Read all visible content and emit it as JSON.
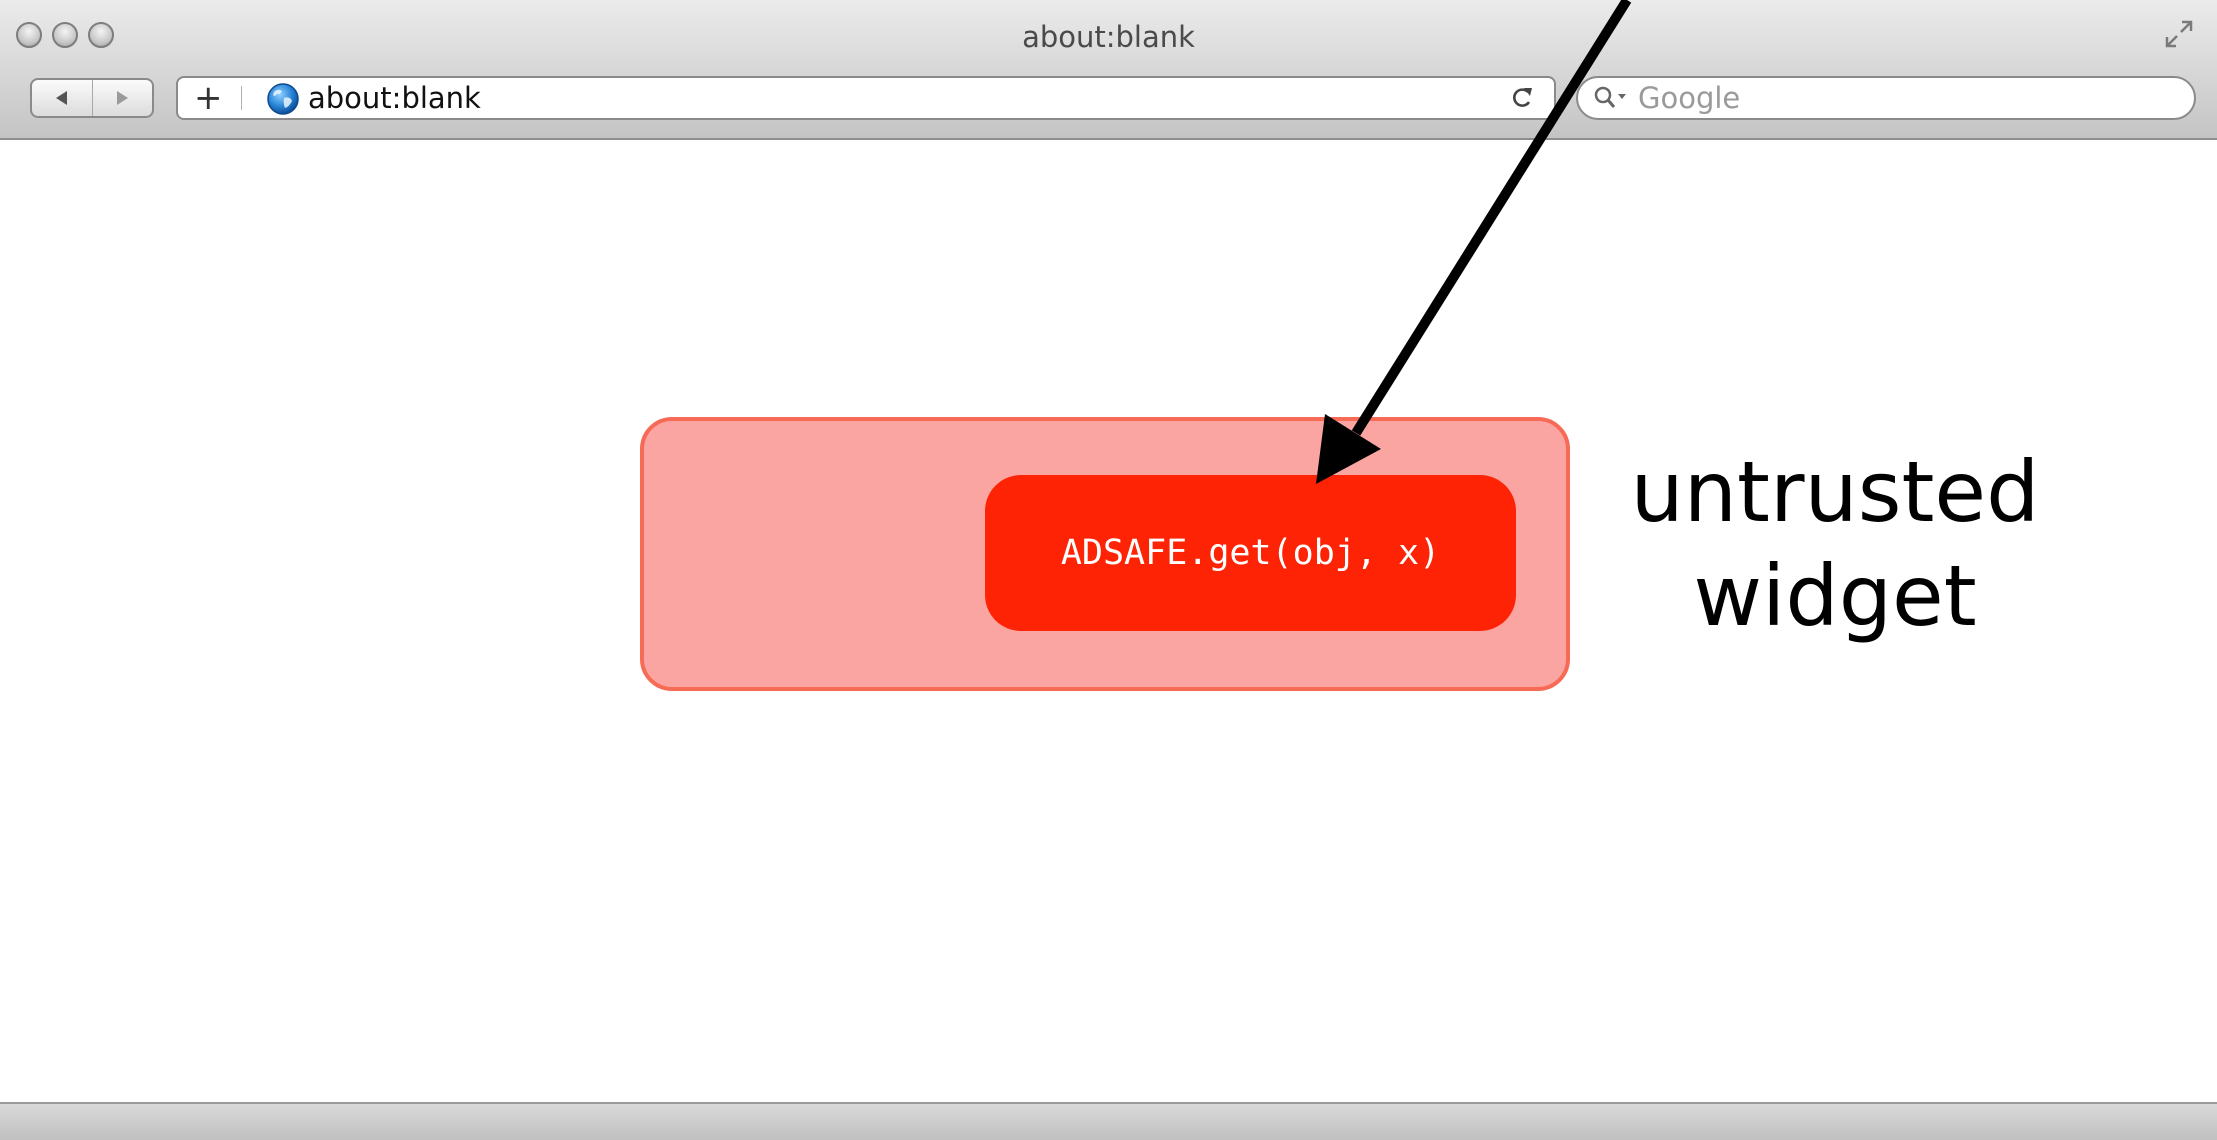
{
  "window": {
    "title": "about:blank"
  },
  "toolbar": {
    "back_icon": "back-arrow-icon",
    "forward_icon": "forward-arrow-icon",
    "add_bookmark_label": "+",
    "url": "about:blank",
    "search_placeholder": "Google"
  },
  "content": {
    "widget_code": "ADSAFE.get(obj, x)",
    "caption_line1": "untrusted",
    "caption_line2": "widget"
  },
  "colors": {
    "widget_outer_fill": "#fba5a2",
    "widget_outer_border": "#f76a56",
    "widget_inner_fill": "#fe2305",
    "arrow": "#000000"
  }
}
